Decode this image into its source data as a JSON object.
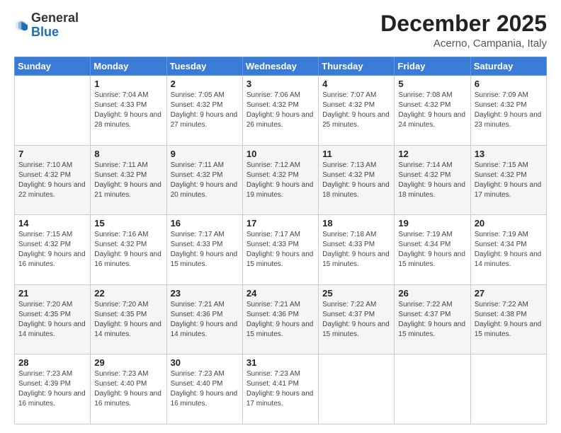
{
  "logo": {
    "general": "General",
    "blue": "Blue"
  },
  "header": {
    "month": "December 2025",
    "location": "Acerno, Campania, Italy"
  },
  "days_of_week": [
    "Sunday",
    "Monday",
    "Tuesday",
    "Wednesday",
    "Thursday",
    "Friday",
    "Saturday"
  ],
  "weeks": [
    [
      {
        "day": "",
        "sunrise": "",
        "sunset": "",
        "daylight": ""
      },
      {
        "day": "1",
        "sunrise": "Sunrise: 7:04 AM",
        "sunset": "Sunset: 4:33 PM",
        "daylight": "Daylight: 9 hours and 28 minutes."
      },
      {
        "day": "2",
        "sunrise": "Sunrise: 7:05 AM",
        "sunset": "Sunset: 4:32 PM",
        "daylight": "Daylight: 9 hours and 27 minutes."
      },
      {
        "day": "3",
        "sunrise": "Sunrise: 7:06 AM",
        "sunset": "Sunset: 4:32 PM",
        "daylight": "Daylight: 9 hours and 26 minutes."
      },
      {
        "day": "4",
        "sunrise": "Sunrise: 7:07 AM",
        "sunset": "Sunset: 4:32 PM",
        "daylight": "Daylight: 9 hours and 25 minutes."
      },
      {
        "day": "5",
        "sunrise": "Sunrise: 7:08 AM",
        "sunset": "Sunset: 4:32 PM",
        "daylight": "Daylight: 9 hours and 24 minutes."
      },
      {
        "day": "6",
        "sunrise": "Sunrise: 7:09 AM",
        "sunset": "Sunset: 4:32 PM",
        "daylight": "Daylight: 9 hours and 23 minutes."
      }
    ],
    [
      {
        "day": "7",
        "sunrise": "Sunrise: 7:10 AM",
        "sunset": "Sunset: 4:32 PM",
        "daylight": "Daylight: 9 hours and 22 minutes."
      },
      {
        "day": "8",
        "sunrise": "Sunrise: 7:11 AM",
        "sunset": "Sunset: 4:32 PM",
        "daylight": "Daylight: 9 hours and 21 minutes."
      },
      {
        "day": "9",
        "sunrise": "Sunrise: 7:11 AM",
        "sunset": "Sunset: 4:32 PM",
        "daylight": "Daylight: 9 hours and 20 minutes."
      },
      {
        "day": "10",
        "sunrise": "Sunrise: 7:12 AM",
        "sunset": "Sunset: 4:32 PM",
        "daylight": "Daylight: 9 hours and 19 minutes."
      },
      {
        "day": "11",
        "sunrise": "Sunrise: 7:13 AM",
        "sunset": "Sunset: 4:32 PM",
        "daylight": "Daylight: 9 hours and 18 minutes."
      },
      {
        "day": "12",
        "sunrise": "Sunrise: 7:14 AM",
        "sunset": "Sunset: 4:32 PM",
        "daylight": "Daylight: 9 hours and 18 minutes."
      },
      {
        "day": "13",
        "sunrise": "Sunrise: 7:15 AM",
        "sunset": "Sunset: 4:32 PM",
        "daylight": "Daylight: 9 hours and 17 minutes."
      }
    ],
    [
      {
        "day": "14",
        "sunrise": "Sunrise: 7:15 AM",
        "sunset": "Sunset: 4:32 PM",
        "daylight": "Daylight: 9 hours and 16 minutes."
      },
      {
        "day": "15",
        "sunrise": "Sunrise: 7:16 AM",
        "sunset": "Sunset: 4:32 PM",
        "daylight": "Daylight: 9 hours and 16 minutes."
      },
      {
        "day": "16",
        "sunrise": "Sunrise: 7:17 AM",
        "sunset": "Sunset: 4:33 PM",
        "daylight": "Daylight: 9 hours and 15 minutes."
      },
      {
        "day": "17",
        "sunrise": "Sunrise: 7:17 AM",
        "sunset": "Sunset: 4:33 PM",
        "daylight": "Daylight: 9 hours and 15 minutes."
      },
      {
        "day": "18",
        "sunrise": "Sunrise: 7:18 AM",
        "sunset": "Sunset: 4:33 PM",
        "daylight": "Daylight: 9 hours and 15 minutes."
      },
      {
        "day": "19",
        "sunrise": "Sunrise: 7:19 AM",
        "sunset": "Sunset: 4:34 PM",
        "daylight": "Daylight: 9 hours and 15 minutes."
      },
      {
        "day": "20",
        "sunrise": "Sunrise: 7:19 AM",
        "sunset": "Sunset: 4:34 PM",
        "daylight": "Daylight: 9 hours and 14 minutes."
      }
    ],
    [
      {
        "day": "21",
        "sunrise": "Sunrise: 7:20 AM",
        "sunset": "Sunset: 4:35 PM",
        "daylight": "Daylight: 9 hours and 14 minutes."
      },
      {
        "day": "22",
        "sunrise": "Sunrise: 7:20 AM",
        "sunset": "Sunset: 4:35 PM",
        "daylight": "Daylight: 9 hours and 14 minutes."
      },
      {
        "day": "23",
        "sunrise": "Sunrise: 7:21 AM",
        "sunset": "Sunset: 4:36 PM",
        "daylight": "Daylight: 9 hours and 14 minutes."
      },
      {
        "day": "24",
        "sunrise": "Sunrise: 7:21 AM",
        "sunset": "Sunset: 4:36 PM",
        "daylight": "Daylight: 9 hours and 15 minutes."
      },
      {
        "day": "25",
        "sunrise": "Sunrise: 7:22 AM",
        "sunset": "Sunset: 4:37 PM",
        "daylight": "Daylight: 9 hours and 15 minutes."
      },
      {
        "day": "26",
        "sunrise": "Sunrise: 7:22 AM",
        "sunset": "Sunset: 4:37 PM",
        "daylight": "Daylight: 9 hours and 15 minutes."
      },
      {
        "day": "27",
        "sunrise": "Sunrise: 7:22 AM",
        "sunset": "Sunset: 4:38 PM",
        "daylight": "Daylight: 9 hours and 15 minutes."
      }
    ],
    [
      {
        "day": "28",
        "sunrise": "Sunrise: 7:23 AM",
        "sunset": "Sunset: 4:39 PM",
        "daylight": "Daylight: 9 hours and 16 minutes."
      },
      {
        "day": "29",
        "sunrise": "Sunrise: 7:23 AM",
        "sunset": "Sunset: 4:40 PM",
        "daylight": "Daylight: 9 hours and 16 minutes."
      },
      {
        "day": "30",
        "sunrise": "Sunrise: 7:23 AM",
        "sunset": "Sunset: 4:40 PM",
        "daylight": "Daylight: 9 hours and 16 minutes."
      },
      {
        "day": "31",
        "sunrise": "Sunrise: 7:23 AM",
        "sunset": "Sunset: 4:41 PM",
        "daylight": "Daylight: 9 hours and 17 minutes."
      },
      {
        "day": "",
        "sunrise": "",
        "sunset": "",
        "daylight": ""
      },
      {
        "day": "",
        "sunrise": "",
        "sunset": "",
        "daylight": ""
      },
      {
        "day": "",
        "sunrise": "",
        "sunset": "",
        "daylight": ""
      }
    ]
  ]
}
